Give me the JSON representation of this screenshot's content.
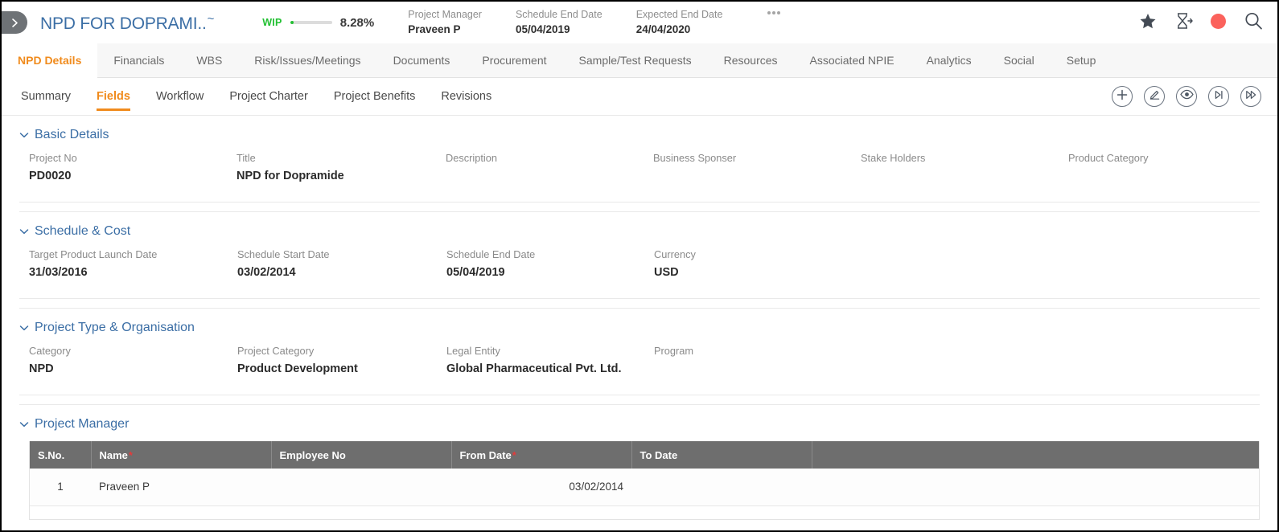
{
  "header": {
    "sidebar_toggle_icon": "chevron-right-icon",
    "project_title": "NPD FOR DOPRAMI..",
    "title_suffix": "~",
    "status": {
      "label": "WIP",
      "percent_text": "8.28%",
      "percent_value": 8.28,
      "color": "#22c032"
    },
    "meta": [
      {
        "label": "Project Manager",
        "value": "Praveen P"
      },
      {
        "label": "Schedule End Date",
        "value": "05/04/2019"
      },
      {
        "label": "Expected End Date",
        "value": "24/04/2020"
      }
    ],
    "more_menu_icon": "ellipsis-icon",
    "actions": [
      {
        "name": "favorite-star-icon",
        "icon": "star-icon"
      },
      {
        "name": "timesheet-hourglass-icon",
        "icon": "hourglass-add-icon"
      },
      {
        "name": "status-indicator",
        "icon": "red-dot-icon",
        "color": "#fb625c"
      },
      {
        "name": "search-icon",
        "icon": "magnifier-icon"
      }
    ]
  },
  "tabs": [
    {
      "label": "NPD Details",
      "active": true
    },
    {
      "label": "Financials",
      "active": false
    },
    {
      "label": "WBS",
      "active": false
    },
    {
      "label": "Risk/Issues/Meetings",
      "active": false
    },
    {
      "label": "Documents",
      "active": false
    },
    {
      "label": "Procurement",
      "active": false
    },
    {
      "label": "Sample/Test Requests",
      "active": false
    },
    {
      "label": "Resources",
      "active": false
    },
    {
      "label": "Associated NPIE",
      "active": false
    },
    {
      "label": "Analytics",
      "active": false
    },
    {
      "label": "Social",
      "active": false
    },
    {
      "label": "Setup",
      "active": false
    }
  ],
  "subtabs": [
    {
      "label": "Summary",
      "active": false
    },
    {
      "label": "Fields",
      "active": true
    },
    {
      "label": "Workflow",
      "active": false
    },
    {
      "label": "Project Charter",
      "active": false
    },
    {
      "label": "Project Benefits",
      "active": false
    },
    {
      "label": "Revisions",
      "active": false
    }
  ],
  "subtab_actions": [
    {
      "name": "add-button",
      "icon": "plus-icon"
    },
    {
      "name": "edit-button",
      "icon": "pencil-icon"
    },
    {
      "name": "view-button",
      "icon": "eye-icon"
    },
    {
      "name": "next-step-button",
      "icon": "play-next-icon"
    },
    {
      "name": "fast-forward-button",
      "icon": "fast-forward-icon"
    }
  ],
  "sections": {
    "basic_details": {
      "title": "Basic Details",
      "fields": [
        {
          "label": "Project No",
          "value": "PD0020"
        },
        {
          "label": "Title",
          "value": "NPD for Dopramide"
        },
        {
          "label": "Description",
          "value": ""
        },
        {
          "label": "Business Sponser",
          "value": ""
        },
        {
          "label": "Stake Holders",
          "value": ""
        },
        {
          "label": "Product Category",
          "value": ""
        }
      ]
    },
    "schedule_cost": {
      "title": "Schedule & Cost",
      "fields": [
        {
          "label": "Target Product Launch Date",
          "value": "31/03/2016"
        },
        {
          "label": "Schedule Start Date",
          "value": "03/02/2014"
        },
        {
          "label": "Schedule End Date",
          "value": "05/04/2019"
        },
        {
          "label": "Currency",
          "value": "USD"
        }
      ]
    },
    "project_type": {
      "title": "Project Type & Organisation",
      "fields": [
        {
          "label": "Category",
          "value": "NPD"
        },
        {
          "label": "Project Category",
          "value": "Product Development"
        },
        {
          "label": "Legal Entity",
          "value": "Global Pharmaceutical Pvt. Ltd."
        },
        {
          "label": "Program",
          "value": ""
        }
      ]
    },
    "project_manager": {
      "title": "Project Manager",
      "table": {
        "columns": [
          {
            "label": "S.No.",
            "required": false
          },
          {
            "label": "Name",
            "required": true
          },
          {
            "label": "Employee No",
            "required": false
          },
          {
            "label": "From Date",
            "required": true
          },
          {
            "label": "To Date",
            "required": false
          },
          {
            "label": "",
            "required": false
          }
        ],
        "rows": [
          {
            "sno": "1",
            "name": "Praveen P",
            "employee_no": "",
            "from_date": "03/02/2014",
            "to_date": "",
            "pad": ""
          }
        ]
      }
    }
  }
}
